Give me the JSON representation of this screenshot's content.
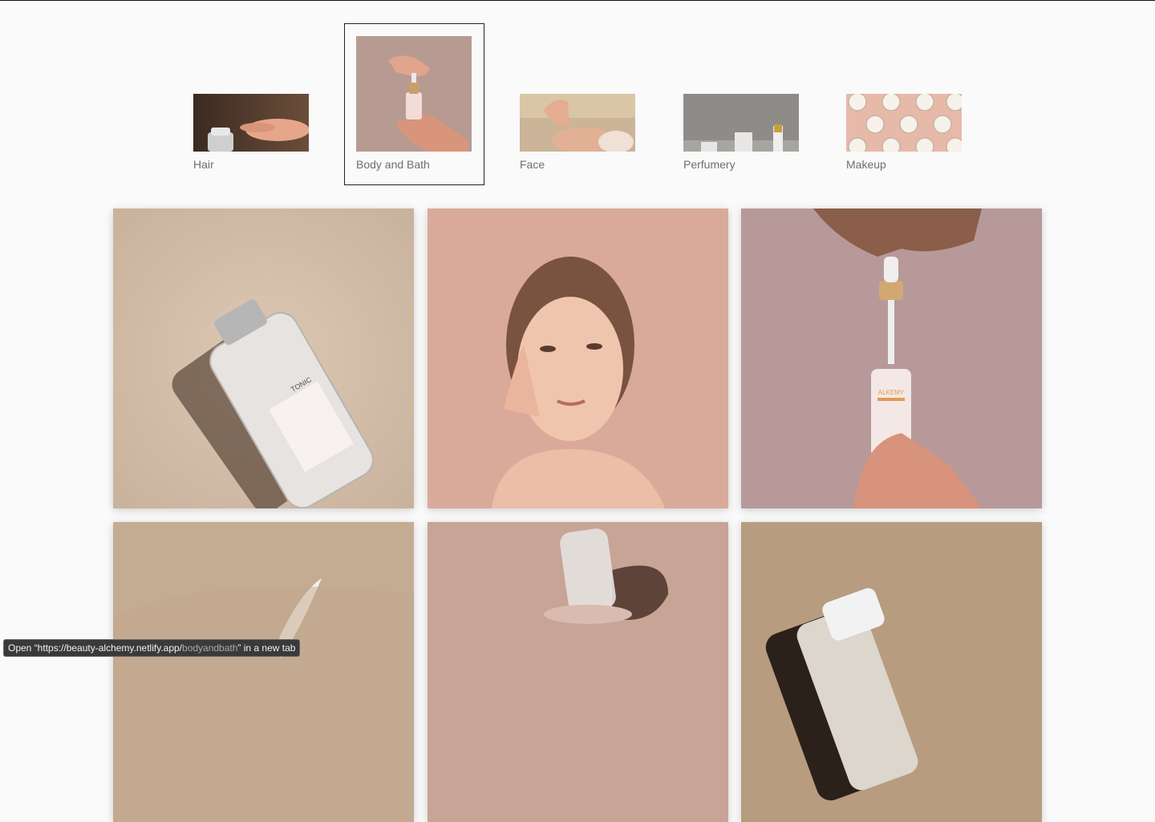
{
  "categories": [
    {
      "id": "hair",
      "label": "Hair",
      "active": false
    },
    {
      "id": "bodyandbath",
      "label": "Body and Bath",
      "active": true
    },
    {
      "id": "face",
      "label": "Face",
      "active": false
    },
    {
      "id": "perfumery",
      "label": "Perfumery",
      "active": false
    },
    {
      "id": "makeup",
      "label": "Makeup",
      "active": false
    }
  ],
  "products": [
    {
      "label": "TONIC"
    },
    {
      "label": ""
    },
    {
      "label": "ALKEMY"
    },
    {
      "label": ""
    },
    {
      "label": ""
    },
    {
      "label": ""
    }
  ],
  "status_bar": {
    "prefix": "Open “https://beauty-alchemy.netlify.app/",
    "path": "bodyandbath",
    "suffix": "” in a new tab"
  },
  "colors": {
    "background": "#fafafa",
    "label_text": "#6e6e6e",
    "active_border": "#222222"
  }
}
